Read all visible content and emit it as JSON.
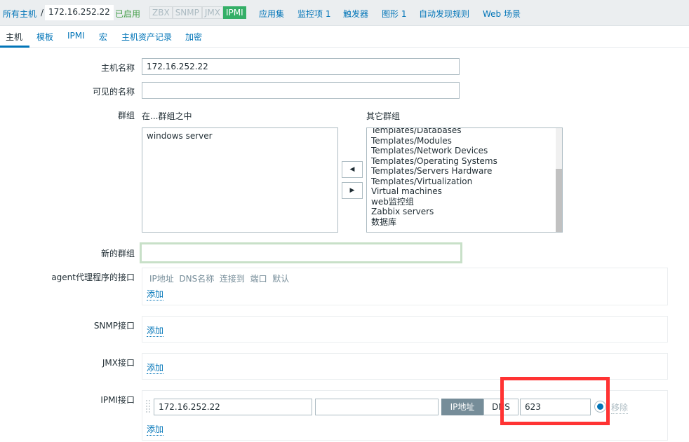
{
  "header": {
    "breadcrumb_root": "所有主机",
    "separator": "/",
    "host": "172.16.252.22",
    "status": "已启用",
    "availability": [
      "ZBX",
      "SNMP",
      "JMX",
      "IPMI"
    ],
    "nav": [
      "应用集",
      "监控项 1",
      "触发器",
      "图形 1",
      "自动发现规则",
      "Web 场景"
    ]
  },
  "tabs": [
    "主机",
    "模板",
    "IPMI",
    "宏",
    "主机资产记录",
    "加密"
  ],
  "form": {
    "host_name_label": "主机名称",
    "host_name": "172.16.252.22",
    "visible_name_label": "可见的名称",
    "visible_name": "",
    "groups_label": "群组",
    "in_groups_label": "在...群组之中",
    "other_groups_label": "其它群组",
    "in_groups": [
      "windows server"
    ],
    "other_groups": [
      "Templates/Databases",
      "Templates/Modules",
      "Templates/Network Devices",
      "Templates/Operating Systems",
      "Templates/Servers Hardware",
      "Templates/Virtualization",
      "Virtual machines",
      "web监控组",
      "Zabbix servers",
      "数据库"
    ],
    "new_group_label": "新的群组",
    "new_group": "",
    "agent_label": "agent代理程序的接口",
    "agent_cols": [
      "IP地址",
      "DNS名称",
      "连接到",
      "端口",
      "默认"
    ],
    "snmp_label": "SNMP接口",
    "jmx_label": "JMX接口",
    "ipmi_label": "IPMI接口",
    "add": "添加",
    "ipmi": {
      "ip": "172.16.252.22",
      "dns": "",
      "connect_ip": "IP地址",
      "connect_dns": "DNS",
      "port": "623",
      "remove": "移除"
    }
  },
  "colors": {
    "accent": "#0275b8",
    "enabled": "#429e47",
    "highlight": "#ff3333"
  }
}
